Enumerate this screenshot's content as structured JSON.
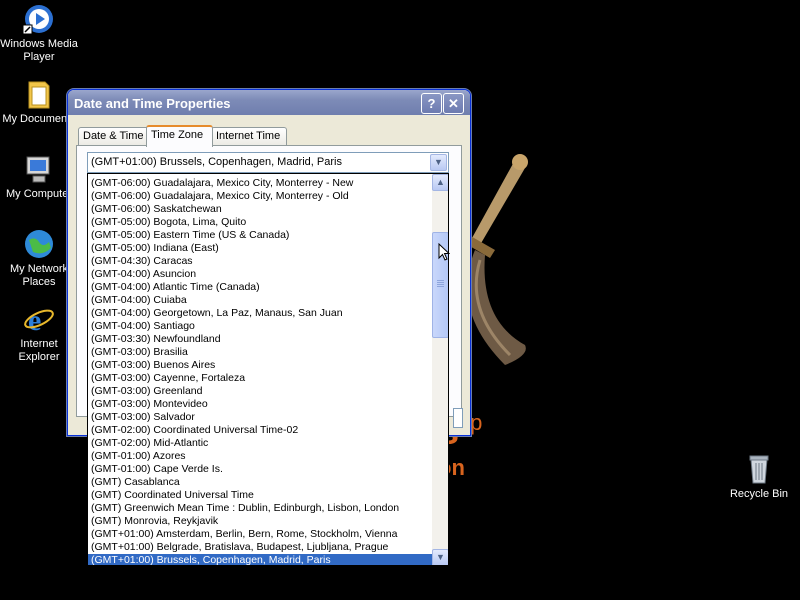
{
  "desktop": {
    "icons": [
      {
        "label": "Windows Media Player"
      },
      {
        "label": "My Documents"
      },
      {
        "label": "My Computer"
      },
      {
        "label": "My Network Places"
      },
      {
        "label": "Internet Explorer"
      },
      {
        "label": "Recycle Bin"
      }
    ],
    "wallpaper": {
      "logo": "s",
      "logo_sup": "xp",
      "sub": "on"
    }
  },
  "window": {
    "title": "Date and Time Properties",
    "help_label": "?",
    "close_label": "✕",
    "tabs": [
      {
        "label": "Date & Time",
        "active": false
      },
      {
        "label": "Time Zone",
        "active": true
      },
      {
        "label": "Internet Time",
        "active": false
      }
    ],
    "timezone_combo": {
      "value": "(GMT+01:00) Brussels, Copenhagen, Madrid, Paris"
    },
    "dropdown": {
      "options": [
        "(GMT-06:00) Guadalajara, Mexico City, Monterrey - New",
        "(GMT-06:00) Guadalajara, Mexico City, Monterrey - Old",
        "(GMT-06:00) Saskatchewan",
        "(GMT-05:00) Bogota, Lima, Quito",
        "(GMT-05:00) Eastern Time (US & Canada)",
        "(GMT-05:00) Indiana (East)",
        "(GMT-04:30) Caracas",
        "(GMT-04:00) Asuncion",
        "(GMT-04:00) Atlantic Time (Canada)",
        "(GMT-04:00) Cuiaba",
        "(GMT-04:00) Georgetown, La Paz, Manaus, San Juan",
        "(GMT-04:00) Santiago",
        "(GMT-03:30) Newfoundland",
        "(GMT-03:00) Brasilia",
        "(GMT-03:00) Buenos Aires",
        "(GMT-03:00) Cayenne, Fortaleza",
        "(GMT-03:00) Greenland",
        "(GMT-03:00) Montevideo",
        "(GMT-03:00) Salvador",
        "(GMT-02:00) Coordinated Universal Time-02",
        "(GMT-02:00) Mid-Atlantic",
        "(GMT-01:00) Azores",
        "(GMT-01:00) Cape Verde Is.",
        "(GMT) Casablanca",
        "(GMT) Coordinated Universal Time",
        "(GMT) Greenwich Mean Time : Dublin, Edinburgh, Lisbon, London",
        "(GMT) Monrovia, Reykjavik",
        "(GMT+01:00) Amsterdam, Berlin, Bern, Rome, Stockholm, Vienna",
        "(GMT+01:00) Belgrade, Bratislava, Budapest, Ljubljana, Prague",
        "(GMT+01:00) Brussels, Copenhagen, Madrid, Paris"
      ],
      "selected_index": 29
    }
  },
  "colors": {
    "selection": "#316ac5",
    "accent_tab": "#e68b2c",
    "wallpaper_text": "#d8641e"
  }
}
